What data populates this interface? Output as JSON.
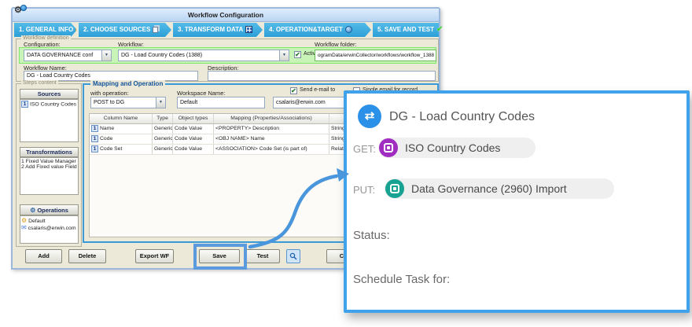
{
  "window": {
    "title": "Workflow Configuration"
  },
  "tabs": [
    {
      "label": "1. GENERAL INFO"
    },
    {
      "label": "2. CHOOSE SOURCES"
    },
    {
      "label": "3. TRANSFORM DATA"
    },
    {
      "label": "4. OPERATION&TARGET"
    },
    {
      "label": "5. SAVE AND TEST"
    }
  ],
  "workflow_definition": {
    "group_label": "Workflow definition",
    "configuration_label": "Configuration:",
    "configuration_value": "DATA GOVERNANCE conf",
    "workflow_label": "Workflow:",
    "workflow_value": "DG - Load Country Codes (1388)",
    "active_label": "Active",
    "workflow_folder_label": "Workflow folder:",
    "workflow_folder_value": "ogramData/erwinCollector/workflows/workflow_1388",
    "workflow_name_label": "Workflow Name:",
    "workflow_name_value": "DG - Load Country Codes",
    "description_label": "Description:",
    "description_value": ""
  },
  "steps_content": {
    "group_label": "Steps content",
    "sources_header": "Sources",
    "sources_items": [
      {
        "num": "1",
        "label": "ISO Country Codes"
      }
    ],
    "transformations_header": "Transformations",
    "transformations_items": [
      {
        "label": "1 Fixed Value Manager"
      },
      {
        "label": "2 Add Fixed value Field"
      }
    ],
    "operations_header": "Operations",
    "operations_items": [
      {
        "icon": "gear-icon",
        "label": "Default"
      },
      {
        "icon": "mail-icon",
        "label": "csalaris@erwin.com"
      }
    ]
  },
  "mapping_operation": {
    "group_label": "Mapping and Operation",
    "with_operation_label": "with operation:",
    "with_operation_value": "POST to DG",
    "workspace_name_label": "Workspace Name:",
    "workspace_name_value": "Default",
    "send_email_label": "Send e-mail to",
    "send_email_value": "csalaris@erwin.com",
    "single_email_label": "Single email for record",
    "table": {
      "headers": [
        "Column Name",
        "Type",
        "Object types",
        "Mapping (Properties/Associations)"
      ],
      "rows": [
        {
          "num": "1",
          "column_name": "Name",
          "type": "Generic ...",
          "object_types": "Code Value",
          "mapping": "<PROPERTY> Description",
          "mapping_type": "String"
        },
        {
          "num": "1",
          "column_name": "Code",
          "type": "Generic ...",
          "object_types": "Code Value",
          "mapping": "<OBJ NAME> Name",
          "mapping_type": "String"
        },
        {
          "num": "1",
          "column_name": "Code Set",
          "type": "Generic ...",
          "object_types": "Code Value",
          "mapping": "<ASSOCIATION> Code Set (is part of)",
          "mapping_type": "Relati"
        }
      ]
    }
  },
  "buttons": {
    "add": "Add",
    "delete": "Delete",
    "export_wf": "Export WF",
    "save": "Save",
    "test": "Test",
    "cancel": "Cancel"
  },
  "overlay": {
    "workflow_title": "DG - Load Country Codes",
    "get_label": "GET:",
    "get_source": "ISO Country Codes",
    "put_label": "PUT:",
    "put_target": "Data Governance (2960) Import",
    "status_label": "Status:",
    "schedule_label": "Schedule Task for:"
  },
  "colors": {
    "tab_blue": "#33a9df",
    "highlight_green": "#c9f4b8",
    "accent_blue": "#4a96dc",
    "get_purple": "#a02cc0",
    "put_teal": "#17a292",
    "overlay_border": "#3fa2ea"
  }
}
